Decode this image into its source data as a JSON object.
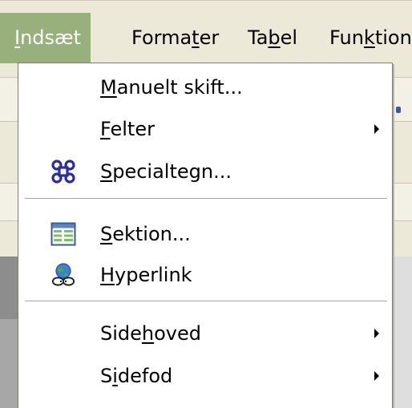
{
  "menubar": {
    "items": [
      {
        "pre": "",
        "acc": "I",
        "post": "ndsæt"
      },
      {
        "pre": "Forma",
        "acc": "t",
        "post": "er"
      },
      {
        "pre": "Ta",
        "acc": "b",
        "post": "el"
      },
      {
        "pre": "Fun",
        "acc": "k",
        "post": "tioner"
      }
    ]
  },
  "dropdown": {
    "items": [
      {
        "pre": "",
        "acc": "M",
        "post": "anuelt skift...",
        "icon": null,
        "submenu": false
      },
      {
        "pre": "",
        "acc": "F",
        "post": "elter",
        "icon": null,
        "submenu": true
      },
      {
        "pre": "",
        "acc": "S",
        "post": "pecialtegn...",
        "icon": "command-symbol-icon",
        "submenu": false
      },
      {
        "pre": "",
        "acc": "S",
        "post": "ektion...",
        "icon": "section-table-icon",
        "submenu": false
      },
      {
        "pre": "",
        "acc": "H",
        "post": "yperlink",
        "icon": "hyperlink-globe-icon",
        "submenu": false
      },
      {
        "pre": "Side",
        "acc": "h",
        "post": "oved",
        "icon": null,
        "submenu": true
      },
      {
        "pre": "S",
        "acc": "i",
        "post": "defod",
        "icon": null,
        "submenu": true
      }
    ]
  },
  "colors": {
    "menu_active_bg": "#98b07c",
    "menu_bar_bg": "#ece9d8",
    "command_icon": "#2c2ca0"
  }
}
